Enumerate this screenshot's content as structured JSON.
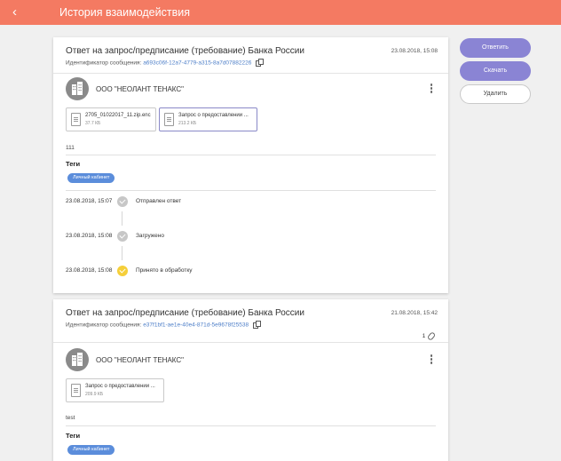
{
  "header": {
    "title": "История взаимодействия",
    "back_icon": "chevron-left-icon",
    "bg_color": "#f47a62"
  },
  "actions": {
    "reply": "Ответить",
    "download": "Скачать",
    "delete": "Удалить"
  },
  "messages": [
    {
      "title": "Ответ на запрос/предписание (требование) Банка России",
      "date": "23.08.2018, 15:08",
      "id_label": "Идентификатор сообщения:",
      "id_value": "a693c06f-12a7-4779-a315-8a7d07882226",
      "company": "ООО \"НЕОЛАНТ ТЕНАКС\"",
      "files": [
        {
          "name": "2705_01022017_11.zip.enc",
          "size": "37.7 КБ"
        },
        {
          "name": "Запрос о предоставлении ...",
          "size": "213.2 КБ"
        }
      ],
      "text": "111",
      "tags_label": "Теги",
      "tags": [
        "Личный кабинет"
      ],
      "timeline": [
        {
          "date": "23.08.2018, 15:07",
          "label": "Отправлен ответ",
          "status": "done"
        },
        {
          "date": "23.08.2018, 15:08",
          "label": "Загружено",
          "status": "done"
        },
        {
          "date": "23.08.2018, 15:08",
          "label": "Принято в обработку",
          "status": "processing"
        }
      ]
    },
    {
      "title": "Ответ на запрос/предписание (требование) Банка России",
      "date": "21.08.2018, 15:42",
      "id_label": "Идентификатор сообщения:",
      "id_value": "e37f1bf1-ae1e-40e4-871d-5e9678f25538",
      "attachments_count": "1",
      "company": "ООО \"НЕОЛАНТ ТЕНАКС\"",
      "files": [
        {
          "name": "Запрос о предоставлении ...",
          "size": "209.9 КБ"
        }
      ],
      "text": "test",
      "tags_label": "Теги",
      "tags": [
        "Личный кабинет"
      ]
    }
  ],
  "colors": {
    "accent": "#8a84d4",
    "tag": "#5b8ddb",
    "link": "#4e7fc8",
    "processing": "#f5cf3a"
  }
}
